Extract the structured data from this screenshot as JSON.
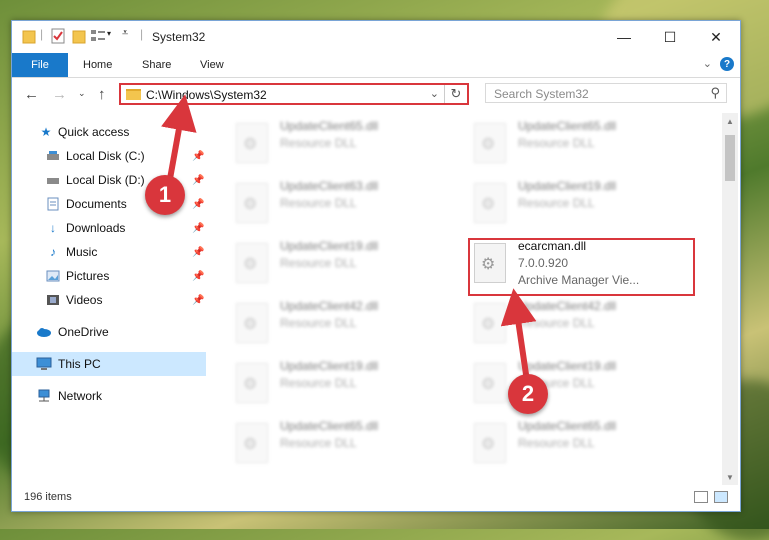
{
  "window": {
    "title": "System32",
    "controls": {
      "minimize": "—",
      "maximize": "☐",
      "close": "✕"
    }
  },
  "ribbon": {
    "file_label": "File",
    "tabs": [
      "Home",
      "Share",
      "View"
    ],
    "help_label": "?"
  },
  "address": {
    "path": "C:\\Windows\\System32",
    "search_placeholder": "Search System32"
  },
  "sidebar": {
    "items": [
      {
        "label": "Quick access",
        "icon": "star-icon"
      },
      {
        "label": "Local Disk (C:)",
        "icon": "drive-icon",
        "pinned": true
      },
      {
        "label": "Local Disk (D:)",
        "icon": "drive-icon",
        "pinned": true
      },
      {
        "label": "Documents",
        "icon": "document-icon",
        "pinned": true
      },
      {
        "label": "Downloads",
        "icon": "download-icon",
        "pinned": true
      },
      {
        "label": "Music",
        "icon": "music-icon",
        "pinned": true
      },
      {
        "label": "Pictures",
        "icon": "pictures-icon",
        "pinned": true
      },
      {
        "label": "Videos",
        "icon": "video-icon",
        "pinned": true
      },
      {
        "label": "OneDrive",
        "icon": "cloud-icon"
      },
      {
        "label": "This PC",
        "icon": "computer-icon",
        "selected": true
      },
      {
        "label": "Network",
        "icon": "network-icon"
      }
    ]
  },
  "files": {
    "left": [
      {
        "name": "UpdateClient65.dll",
        "desc": "Resource DLL"
      },
      {
        "name": "UpdateClient63.dll",
        "desc": "Resource DLL"
      },
      {
        "name": "UpdateClient19.dll",
        "desc": "Resource DLL"
      },
      {
        "name": "UpdateClient42.dll",
        "desc": "Resource DLL"
      },
      {
        "name": "UpdateClient19.dll",
        "desc": "Resource DLL"
      },
      {
        "name": "UpdateClient65.dll",
        "desc": "Resource DLL"
      }
    ],
    "right": [
      {
        "name": "UpdateClient65.dll",
        "desc": "Resource DLL"
      },
      {
        "name": "UpdateClient19.dll",
        "desc": "Resource DLL"
      },
      {
        "name": "UpdateClient42.dll",
        "desc": "Resource DLL"
      },
      {
        "name": "UpdateClient19.dll",
        "desc": "Resource DLL"
      },
      {
        "name": "UpdateClient65.dll",
        "desc": "Resource DLL"
      }
    ],
    "highlighted": {
      "name": "ecarcman.dll",
      "version": "7.0.0.920",
      "desc": "Archive Manager Vie..."
    }
  },
  "status": {
    "count": "196 items"
  },
  "annotations": {
    "marker1": "1",
    "marker2": "2",
    "color": "#d9363c"
  }
}
